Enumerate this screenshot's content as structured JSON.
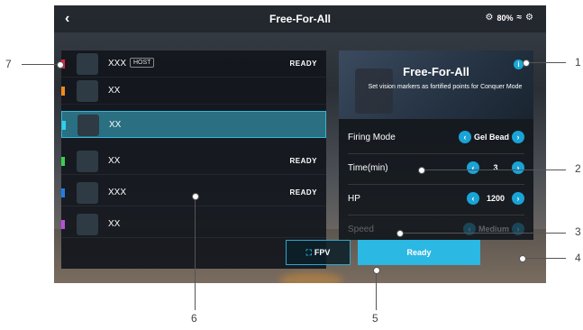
{
  "header": {
    "title": "Free-For-All",
    "battery": "80%"
  },
  "players": [
    {
      "name": "XXX",
      "host_badge": "HOST",
      "status": "READY",
      "color": "#e8203c"
    },
    {
      "name": "XX",
      "status": "",
      "color": "#f28a1e"
    },
    {
      "name": "XX",
      "status": "",
      "color": "#2fd1e8"
    },
    {
      "name": "XX",
      "status": "READY",
      "color": "#3ccf4f"
    },
    {
      "name": "XXX",
      "status": "READY",
      "color": "#1e7ee8"
    },
    {
      "name": "XX",
      "status": "",
      "color": "#b84ee0"
    }
  ],
  "mode": {
    "title": "Free-For-All",
    "description": "Set vision markers as fortified points for Conquer Mode"
  },
  "settings": [
    {
      "label": "Firing Mode",
      "value": "Gel Bead"
    },
    {
      "label": "Time(min)",
      "value": "3"
    },
    {
      "label": "HP",
      "value": "1200"
    },
    {
      "label": "Speed",
      "value": "Medium"
    }
  ],
  "buttons": {
    "fpv": "FPV",
    "ready": "Ready"
  },
  "callouts": [
    "1",
    "2",
    "3",
    "4",
    "5",
    "6",
    "7"
  ],
  "colors": {
    "accent": "#2bb8e3",
    "selected_row": "#2a6f82"
  }
}
